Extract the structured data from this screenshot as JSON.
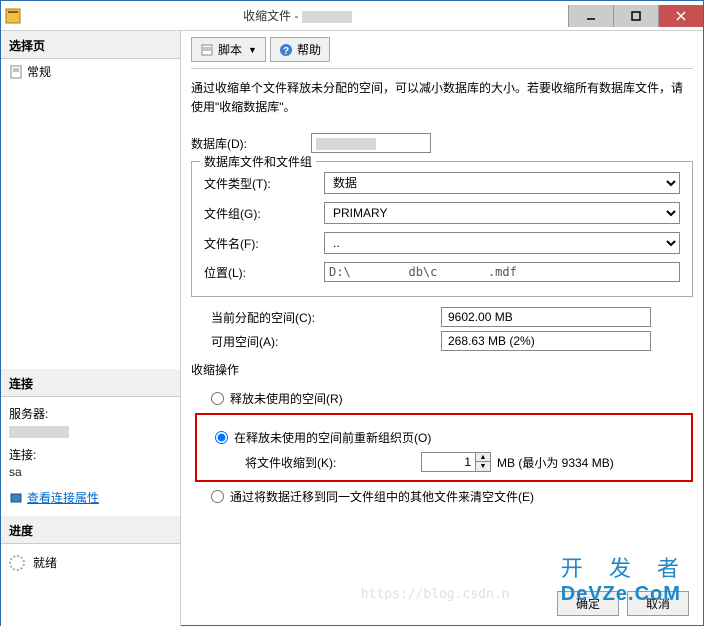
{
  "window": {
    "title_prefix": "收缩文件 - "
  },
  "sidebar": {
    "label_select_page": "选择页",
    "item_general": "常规",
    "label_connection": "连接",
    "label_server": "服务器:",
    "label_conn": "连接:",
    "conn_value": "sa",
    "link_view_props": "查看连接属性",
    "label_progress": "进度",
    "progress_ready": "就绪"
  },
  "toolbar": {
    "script": "脚本",
    "help": "帮助"
  },
  "desc": "通过收缩单个文件释放未分配的空间，可以减小数据库的大小。若要收缩所有数据库文件，请使用\"收缩数据库\"。",
  "fields": {
    "database_label": "数据库(D):",
    "group_label": "数据库文件和文件组",
    "file_type_label": "文件类型(T):",
    "file_type_value": "数据",
    "filegroup_label": "文件组(G):",
    "filegroup_value": "PRIMARY",
    "filename_label": "文件名(F):",
    "filename_value": "..",
    "location_label": "位置(L):",
    "location_value": "D:\\        db\\c       .mdf",
    "current_size_label": "当前分配的空间(C):",
    "current_size_value": "9602.00 MB",
    "avail_label": "可用空间(A):",
    "avail_value": "268.63 MB (2%)"
  },
  "shrink": {
    "title": "收缩操作",
    "opt1": "释放未使用的空间(R)",
    "opt2": "在释放未使用的空间前重新组织页(O)",
    "sub_label": "将文件收缩到(K):",
    "sub_value": "1",
    "sub_unit": "MB (最小为 9334 MB)",
    "opt3": "通过将数据迁移到同一文件组中的其他文件来清空文件(E)"
  },
  "buttons": {
    "ok": "确定",
    "cancel": "取消"
  },
  "watermark": {
    "text1": "开 发 者",
    "text2": "DeVZe.CoM",
    "url": "https://blog.csdn.n"
  }
}
